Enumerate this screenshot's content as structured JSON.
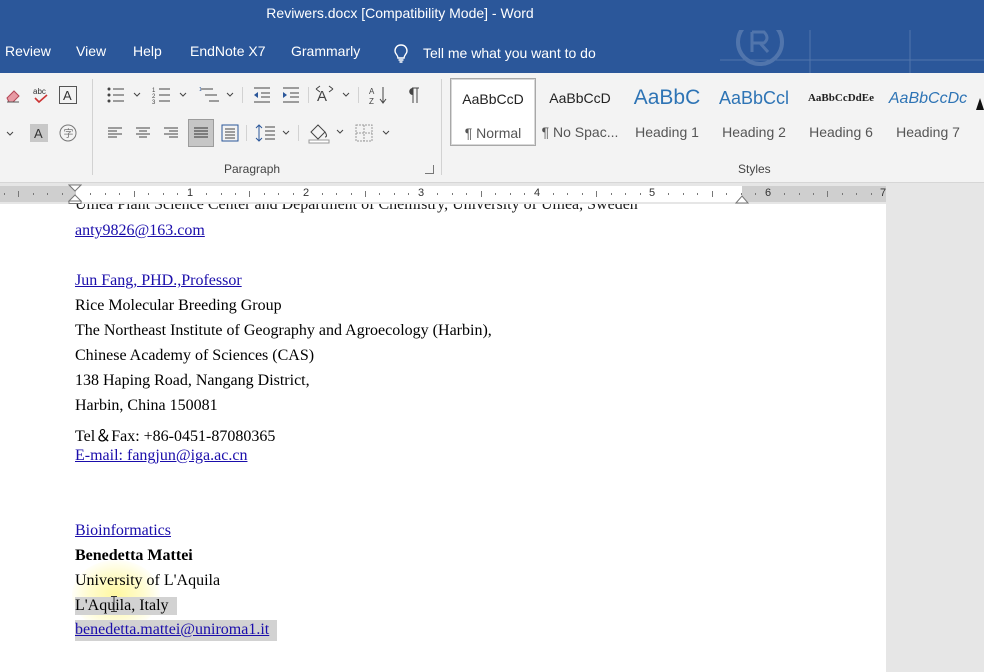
{
  "window": {
    "title": "Reviwers.docx [Compatibility Mode]  -  Word"
  },
  "tabs": [
    {
      "label": "Review"
    },
    {
      "label": "View"
    },
    {
      "label": "Help"
    },
    {
      "label": "EndNote X7"
    },
    {
      "label": "Grammarly"
    }
  ],
  "tell_me": {
    "placeholder": "Tell me what you want to do"
  },
  "ribbon": {
    "groups": {
      "paragraph": "Paragraph",
      "styles": "Styles"
    },
    "styles": [
      {
        "preview": "AaBbCcD",
        "name": "¶ Normal",
        "active": true
      },
      {
        "preview": "AaBbCcD",
        "name": "¶ No Spac..."
      },
      {
        "preview": "AaBbC",
        "name": "Heading 1"
      },
      {
        "preview": "AaBbCcl",
        "name": "Heading 2"
      },
      {
        "preview": "AaBbCcDdEe",
        "name": "Heading 6"
      },
      {
        "preview": "AaBbCcDc",
        "name": "Heading 7"
      }
    ]
  },
  "ruler": {
    "numbers": [
      "1",
      "2",
      "3",
      "4",
      "5",
      "6",
      "7"
    ]
  },
  "document": {
    "lines": [
      "Umea Plant Science Center and Department of Chemistry, University of Umea, Sweden",
      "anty9826@163.com",
      "Jun Fang, PHD.,Professor",
      "Rice Molecular Breeding Group",
      "The Northeast Institute of Geography and Agroecology (Harbin),",
      "Chinese Academy of Sciences (CAS)",
      "138 Haping Road, Nangang District,",
      "Harbin, China 150081",
      "Tel＆Fax: +86-0451-87080365",
      "E-mail: fangjun@iga.ac.cn",
      "Bioinformatics",
      "Benedetta Mattei",
      "University of L'Aquila",
      "L'Aquila, Italy",
      "benedetta.mattei@uniroma1.it"
    ]
  },
  "colors": {
    "word_blue": "#2b579a",
    "link": "#1a0dab",
    "spell_error": "#e0301e"
  }
}
